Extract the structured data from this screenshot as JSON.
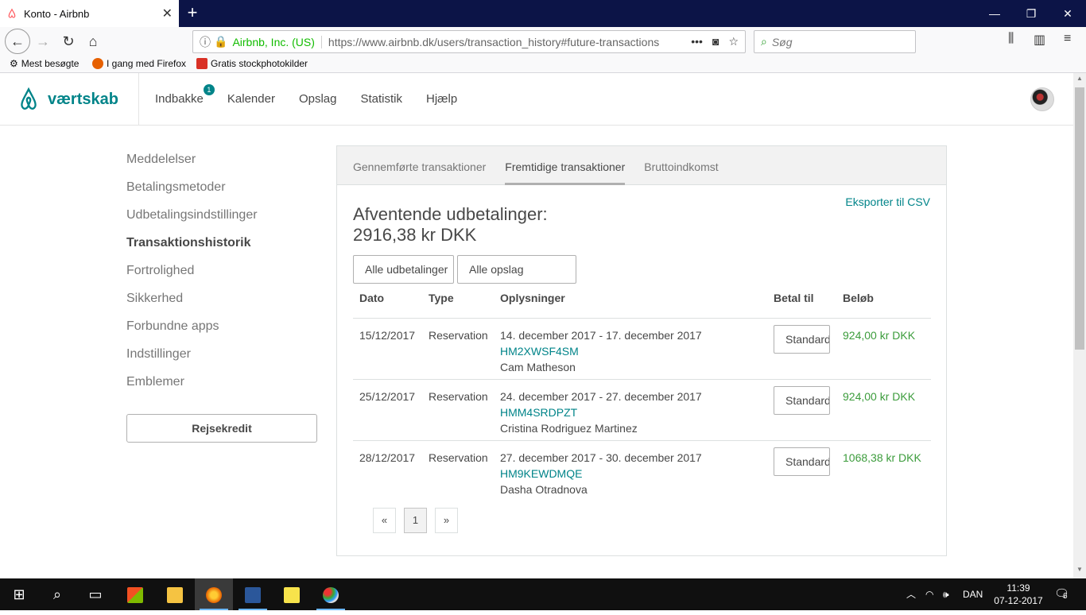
{
  "browser": {
    "tab_title": "Konto - Airbnb",
    "site_identity": "Airbnb, Inc. (US)",
    "url": "https://www.airbnb.dk/users/transaction_history#future-transactions",
    "search_placeholder": "Søg",
    "bookmarks": [
      "Mest besøgte",
      "I gang med Firefox",
      "Gratis stockphotokilder"
    ]
  },
  "header": {
    "logo_text": "værtskab",
    "nav": [
      "Indbakke",
      "Kalender",
      "Opslag",
      "Statistik",
      "Hjælp"
    ],
    "inbox_badge": "1"
  },
  "sidebar": {
    "items": [
      "Meddelelser",
      "Betalingsmetoder",
      "Udbetalingsindstillinger",
      "Transaktionshistorik",
      "Fortrolighed",
      "Sikkerhed",
      "Forbundne apps",
      "Indstillinger",
      "Emblemer"
    ],
    "active_index": 3,
    "travel_credit_button": "Rejsekredit"
  },
  "panel": {
    "tabs": [
      "Gennemførte transaktioner",
      "Fremtidige transaktioner",
      "Bruttoindkomst"
    ],
    "active_tab": 1,
    "export_link": "Eksporter til CSV",
    "pending_label": "Afventende udbetalinger:",
    "pending_amount": "2916,38 kr DKK",
    "filters": [
      "Alle udbetalinger",
      "Alle opslag"
    ],
    "columns": [
      "Dato",
      "Type",
      "Oplysninger",
      "Betal til",
      "Beløb"
    ],
    "rows": [
      {
        "date": "15/12/2017",
        "type": "Reservation",
        "dates": "14. december 2017 - 17. december 2017",
        "code": "HM2XWSF4SM",
        "guest": "Cam Matheson",
        "pay_to": "Standard",
        "amount": "924,00 kr DKK"
      },
      {
        "date": "25/12/2017",
        "type": "Reservation",
        "dates": "24. december 2017 - 27. december 2017",
        "code": "HMM4SRDPZT",
        "guest": "Cristina Rodriguez Martinez",
        "pay_to": "Standard",
        "amount": "924,00 kr DKK"
      },
      {
        "date": "28/12/2017",
        "type": "Reservation",
        "dates": "27. december 2017 - 30. december 2017",
        "code": "HM9KEWDMQE",
        "guest": "Dasha Otradnova",
        "pay_to": "Standard",
        "amount": "1068,38 kr DKK"
      }
    ],
    "pager": {
      "prev": "«",
      "current": "1",
      "next": "»"
    }
  },
  "taskbar": {
    "language": "DAN",
    "time": "11:39",
    "date": "07-12-2017",
    "notifications": "6"
  },
  "colors": {
    "accent": "#008489",
    "amount": "#3c9c3c",
    "tabstrip": "#0c1447"
  }
}
